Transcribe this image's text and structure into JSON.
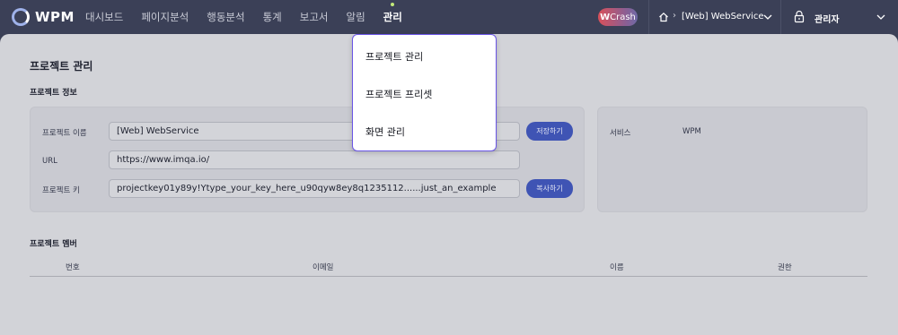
{
  "header": {
    "logo_text": "WPM",
    "nav": [
      {
        "label": "대시보드"
      },
      {
        "label": "페이지분석"
      },
      {
        "label": "행동분석"
      },
      {
        "label": "통계"
      },
      {
        "label": "보고서"
      },
      {
        "label": "알림"
      },
      {
        "label": "관리",
        "active": true
      }
    ],
    "wcrash": {
      "letter": "W",
      "text": "Crash"
    },
    "project_breadcrumb_sep": "›",
    "project_name": "[Web] WebService",
    "user_name": "관리자"
  },
  "dropdown": {
    "items": [
      "프로젝트 관리",
      "프로젝트 프리셋",
      "화면 관리"
    ]
  },
  "page": {
    "title": "프로젝트 관리",
    "info_section_title": "프로젝트 정보",
    "fields": {
      "name_label": "프로젝트 이름",
      "name_value": "[Web] WebService",
      "url_label": "URL",
      "url_value": "https://www.imqa.io/",
      "key_label": "프로젝트 키",
      "key_value": "projectkey01y89y!Ytype_your_key_here_u90qyw8ey8q1235112......just_an_example"
    },
    "buttons": {
      "save": "저장하기",
      "copy": "복사하기"
    },
    "service": {
      "label": "서비스",
      "value": "WPM"
    },
    "members_section_title": "프로젝트 멤버",
    "table_columns": [
      "번호",
      "이메일",
      "이름",
      "권한"
    ]
  },
  "colors": {
    "topbar": "#3b4057",
    "dropdown_border": "#6a55e6",
    "button": "#3f54b4",
    "active_dot": "#c3e97a"
  }
}
